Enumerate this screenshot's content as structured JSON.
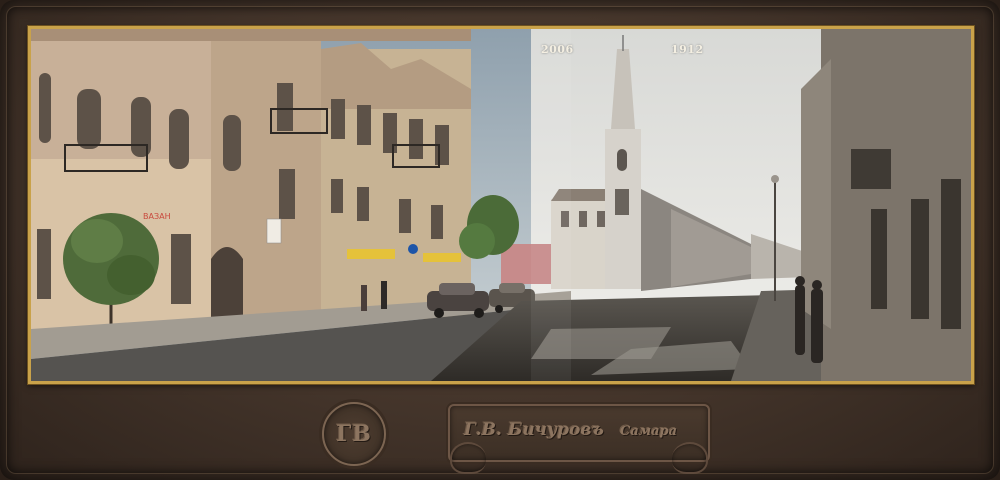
{
  "photo": {
    "years": {
      "left": "2006",
      "right": "1912"
    },
    "left_building_sign": "ВАЗАН",
    "left_shop_sign": "ВАЗАН"
  },
  "mount": {
    "monogram": "ГВ",
    "maker": "Г.В. Бичуровъ",
    "city": "Самара"
  },
  "colors": {
    "mount": "#43342a",
    "frame": "#c9a24a",
    "sky_modern": "#b8c2c8",
    "sky_old": "#e6e6e2"
  }
}
